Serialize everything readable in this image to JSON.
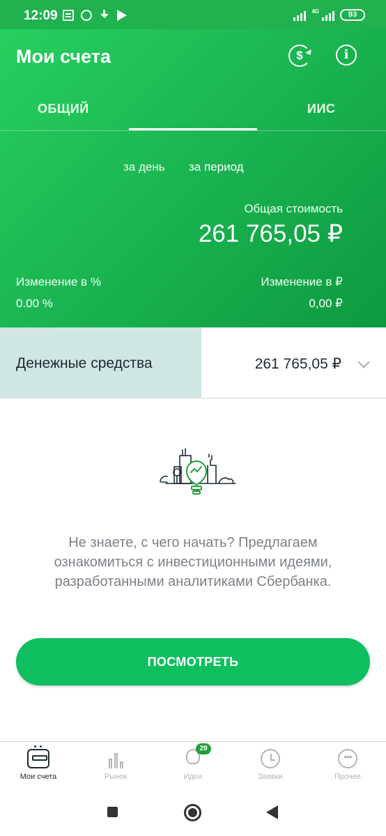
{
  "status_bar": {
    "time": "12:09",
    "network": "4G",
    "battery": "93"
  },
  "header": {
    "title": "Мои счета",
    "tabs": [
      {
        "label": "ОБЩИЙ",
        "active": true
      },
      {
        "label": "ИИС",
        "active": false
      }
    ],
    "period": {
      "day_label": "за день",
      "range_label": "за период"
    },
    "total": {
      "label": "Общая стоимость",
      "value": "261 765,05 ₽"
    },
    "change_percent": {
      "label": "Изменение в  %",
      "value": "0.00  %"
    },
    "change_rub": {
      "label": "Изменение в ₽",
      "value": "0,00 ₽"
    }
  },
  "cash": {
    "label": "Денежные средства",
    "value": "261 765,05 ₽"
  },
  "empty_state": {
    "text": "Не знаете, с чего начать? Предлагаем ознакомиться с инвестиционными идеями, разработанными аналитиками Сбербанка.",
    "button_label": "ПОСМОТРЕТЬ"
  },
  "bottom_nav": {
    "items": [
      {
        "label": "Мои счета",
        "active": true
      },
      {
        "label": "Рынок",
        "active": false
      },
      {
        "label": "Идеи",
        "active": false,
        "badge": "29"
      },
      {
        "label": "Заявки",
        "active": false
      },
      {
        "label": "Прочее",
        "active": false
      }
    ]
  },
  "colors": {
    "brand_green": "#1db955",
    "button_green": "#0fbf5f",
    "cash_highlight": "#cfe6e2",
    "text_dark": "#1c2b33",
    "text_muted": "#7c8188"
  }
}
